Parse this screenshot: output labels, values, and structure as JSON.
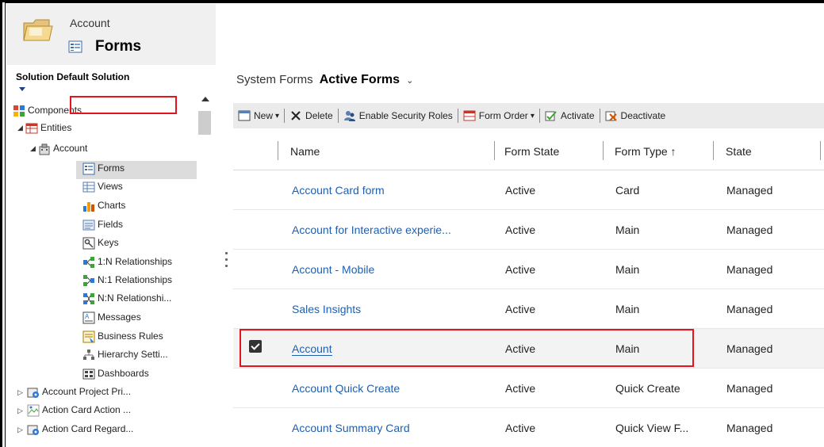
{
  "header": {
    "entity": "Account",
    "title": "Forms"
  },
  "sidebar": {
    "solution_label": "Solution Default Solution",
    "tree": [
      {
        "label": "Components",
        "icon": "components-icon"
      },
      {
        "label": "Entities",
        "icon": "entities-icon"
      },
      {
        "label": "Account",
        "icon": "account-entity-icon"
      },
      {
        "label": "Forms",
        "icon": "forms-icon"
      },
      {
        "label": "Views",
        "icon": "views-icon"
      },
      {
        "label": "Charts",
        "icon": "charts-icon"
      },
      {
        "label": "Fields",
        "icon": "fields-icon"
      },
      {
        "label": "Keys",
        "icon": "keys-icon"
      },
      {
        "label": "1:N Relationships",
        "icon": "one-to-many-icon"
      },
      {
        "label": "N:1 Relationships",
        "icon": "many-to-one-icon"
      },
      {
        "label": "N:N Relationshi...",
        "icon": "many-to-many-icon"
      },
      {
        "label": "Messages",
        "icon": "messages-icon"
      },
      {
        "label": "Business Rules",
        "icon": "business-rules-icon"
      },
      {
        "label": "Hierarchy Setti...",
        "icon": "hierarchy-icon"
      },
      {
        "label": "Dashboards",
        "icon": "dashboards-icon"
      },
      {
        "label": "Account Project Pri...",
        "icon": "entity-gear-icon"
      },
      {
        "label": "Action Card Action ...",
        "icon": "broken-image-icon"
      },
      {
        "label": "Action Card Regard...",
        "icon": "entity-gear-icon"
      }
    ]
  },
  "breadcrumb": {
    "parent": "System Forms",
    "active": "Active Forms",
    "chevron": "⌄"
  },
  "toolbar": {
    "new": "New",
    "delete": "Delete",
    "enable_security_roles": "Enable Security Roles",
    "form_order": "Form Order",
    "activate": "Activate",
    "deactivate": "Deactivate",
    "dropdown_glyph": "▾"
  },
  "grid": {
    "columns": [
      "Name",
      "Form State",
      "Form Type ↑",
      "State"
    ],
    "rows": [
      {
        "name": "Account Card form",
        "form_state": "Active",
        "form_type": "Card",
        "state": "Managed",
        "selected": false
      },
      {
        "name": "Account for Interactive experie...",
        "form_state": "Active",
        "form_type": "Main",
        "state": "Managed",
        "selected": false
      },
      {
        "name": "Account - Mobile",
        "form_state": "Active",
        "form_type": "Main",
        "state": "Managed",
        "selected": false
      },
      {
        "name": "Sales Insights",
        "form_state": "Active",
        "form_type": "Main",
        "state": "Managed",
        "selected": false
      },
      {
        "name": "Account",
        "form_state": "Active",
        "form_type": "Main",
        "state": "Managed",
        "selected": true
      },
      {
        "name": "Account Quick Create",
        "form_state": "Active",
        "form_type": "Quick Create",
        "state": "Managed",
        "selected": false
      },
      {
        "name": "Account Summary Card",
        "form_state": "Active",
        "form_type": "Quick View F...",
        "state": "Managed",
        "selected": false
      }
    ]
  },
  "colors": {
    "highlight_red": "#e5121f",
    "link_blue": "#1f5faf",
    "toolbar_gray": "#ebebeb"
  }
}
